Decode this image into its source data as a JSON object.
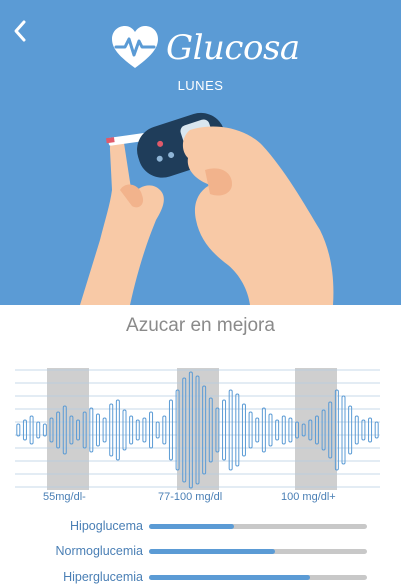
{
  "app": {
    "title": "Glucosa",
    "day": "LUNES",
    "subtitle": "Azucar en mejora"
  },
  "colors": {
    "primary_blue": "#5b9bd5",
    "label_blue": "#4a7fb5",
    "track_gray": "#c8c8c8",
    "band_gray": "#cfcfcf"
  },
  "icons": {
    "back": "chevron-left-icon",
    "logo": "heart-pulse-icon"
  },
  "chart_data": {
    "type": "bar",
    "x_labels": [
      "55mg/dl-",
      "77-100 mg/dl",
      "100 mg/dl+"
    ],
    "highlight_ranges": [
      "55mg/dl-",
      "77-100 mg/dl",
      "100 mg/dl+"
    ],
    "grid": true
  },
  "levels": [
    {
      "label": "Hipoglucema",
      "value": 0.39
    },
    {
      "label": "Normoglucemia",
      "value": 0.58
    },
    {
      "label": "Hiperglucemia",
      "value": 0.74
    }
  ]
}
